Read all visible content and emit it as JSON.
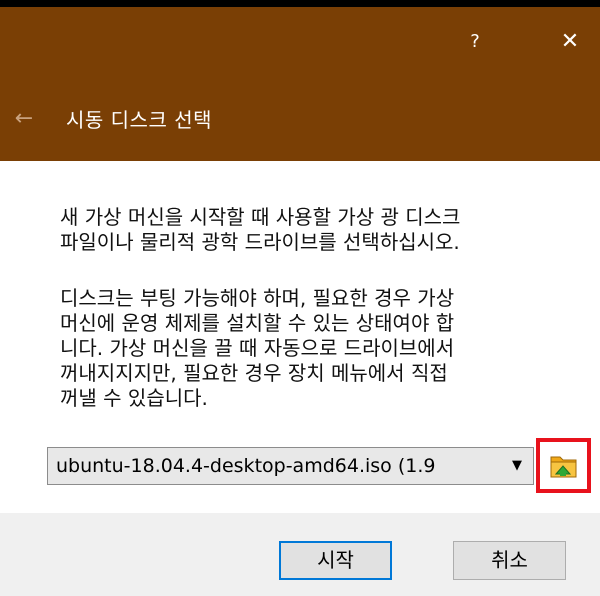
{
  "titlebar": {
    "help_label": "?",
    "close_label": "✕",
    "back_label": "←",
    "title": "시동 디스크 선택"
  },
  "content": {
    "paragraph1": [
      "새 가상 머신을 시작할 때 사용할 가상 광 디스크",
      "파일이나 물리적 광학 드라이브를 선택하십시오."
    ],
    "paragraph2": [
      "디스크는 부팅 가능해야 하며, 필요한 경우 가상",
      "머신에 운영 체제를 설치할 수 있는 상태여야 합",
      "니다. 가상 머신을 끌 때 자동으로 드라이브에서",
      "꺼내지지지만, 필요한 경우 장치 메뉴에서 직접",
      "꺼낼 수 있습니다."
    ],
    "disk_select": {
      "selected": "ubuntu-18.04.4-desktop-amd64.iso (1.9",
      "arrow": "▼"
    },
    "folder_icon": "folder-green-arrow-icon"
  },
  "footer": {
    "start_label": "시작",
    "cancel_label": "취소"
  },
  "colors": {
    "titlebar": "#7a3f05",
    "highlight_border": "#e8121c",
    "default_button_border": "#0078d7"
  }
}
